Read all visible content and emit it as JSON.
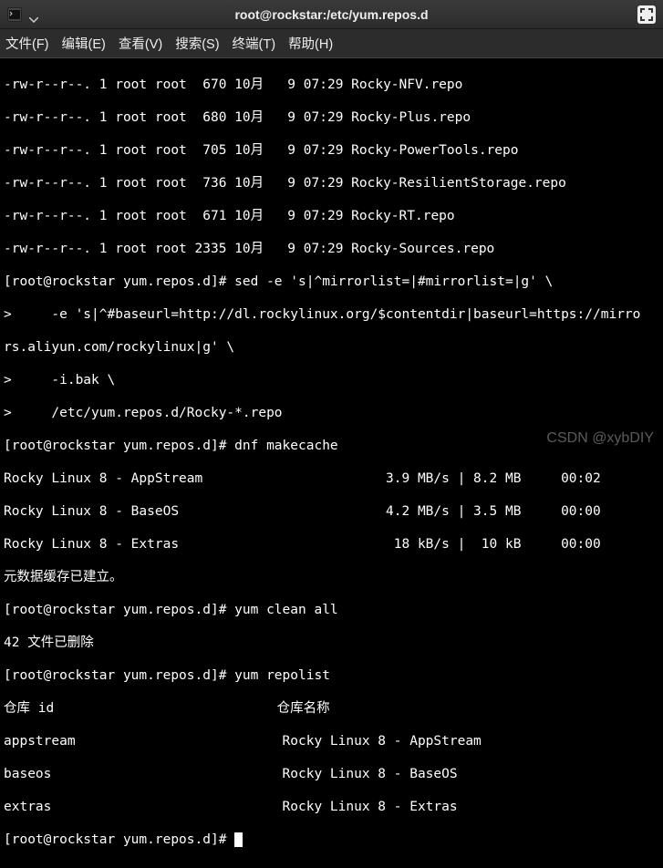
{
  "window": {
    "title": "root@rockstar:/etc/yum.repos.d"
  },
  "menu": {
    "file": "文件(F)",
    "edit": "编辑(E)",
    "view": "查看(V)",
    "search": "搜索(S)",
    "terminal": "终端(T)",
    "help": "帮助(H)"
  },
  "lines": {
    "l0": "-rw-r--r--. 1 root root  670 10月   9 07:29 Rocky-NFV.repo",
    "l1": "-rw-r--r--. 1 root root  680 10月   9 07:29 Rocky-Plus.repo",
    "l2": "-rw-r--r--. 1 root root  705 10月   9 07:29 Rocky-PowerTools.repo",
    "l3": "-rw-r--r--. 1 root root  736 10月   9 07:29 Rocky-ResilientStorage.repo",
    "l4": "-rw-r--r--. 1 root root  671 10月   9 07:29 Rocky-RT.repo",
    "l5": "-rw-r--r--. 1 root root 2335 10月   9 07:29 Rocky-Sources.repo",
    "l6": "[root@rockstar yum.repos.d]# sed -e 's|^mirrorlist=|#mirrorlist=|g' \\",
    "l7": ">     -e 's|^#baseurl=http://dl.rockylinux.org/$contentdir|baseurl=https://mirro",
    "l8": "rs.aliyun.com/rockylinux|g' \\",
    "l9": ">     -i.bak \\",
    "l10": ">     /etc/yum.repos.d/Rocky-*.repo",
    "l11": "[root@rockstar yum.repos.d]# dnf makecache",
    "l12": "Rocky Linux 8 - AppStream                       3.9 MB/s | 8.2 MB     00:02",
    "l13": "Rocky Linux 8 - BaseOS                          4.2 MB/s | 3.5 MB     00:00",
    "l14": "Rocky Linux 8 - Extras                           18 kB/s |  10 kB     00:00",
    "l15": "元数据缓存已建立。",
    "l16": "[root@rockstar yum.repos.d]# yum clean all",
    "l17": "42 文件已删除",
    "l18": "[root@rockstar yum.repos.d]# yum repolist",
    "l19": "仓库 id                            仓库名称",
    "l20": "appstream                          Rocky Linux 8 - AppStream",
    "l21": "baseos                             Rocky Linux 8 - BaseOS",
    "l22": "extras                             Rocky Linux 8 - Extras",
    "l23": "[root@rockstar yum.repos.d]# "
  },
  "watermark": "CSDN @xybDIY"
}
